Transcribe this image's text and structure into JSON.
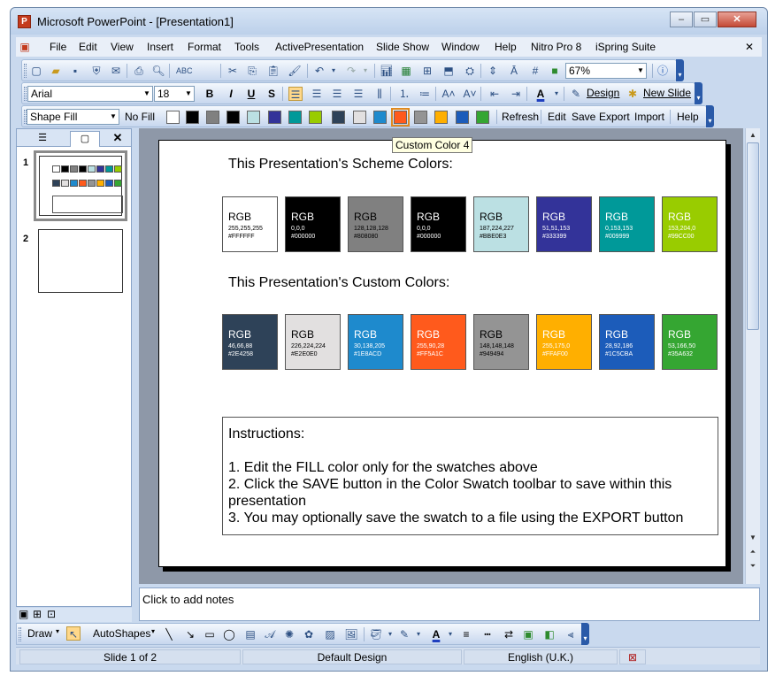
{
  "window": {
    "title": "Microsoft PowerPoint - [Presentation1]"
  },
  "menu": [
    "File",
    "Edit",
    "View",
    "Insert",
    "Format",
    "Tools",
    "ActivePresentation",
    "Slide Show",
    "Window",
    "Help",
    "Nitro Pro 8",
    "iSpring Suite"
  ],
  "standard_toolbar": {
    "zoom": "67%"
  },
  "format_toolbar": {
    "font": "Arial",
    "size": "18",
    "design_label": "Design",
    "new_slide_label": "New Slide"
  },
  "swatch_toolbar": {
    "shape_fill": "Shape Fill",
    "no_fill": "No Fill",
    "colors": [
      "#FFFFFF",
      "#000000",
      "#808080",
      "#000000",
      "#BBE0E3",
      "#333399",
      "#009999",
      "#99CC00",
      "#2E4258",
      "#E2E0E0",
      "#1E8ACD",
      "#FF5A1C",
      "#949494",
      "#FFAF00",
      "#1C5CBA",
      "#35A632"
    ],
    "buttons": [
      "Refresh",
      "Edit",
      "Save",
      "Export",
      "Import",
      "Help"
    ],
    "tooltip": "Custom Color 4"
  },
  "slides_pane": {
    "slide_numbers": [
      "1",
      "2"
    ]
  },
  "slide": {
    "scheme_heading": "This Presentation's Scheme Colors:",
    "custom_heading": "This Presentation's Custom Colors:",
    "scheme_swatches": [
      {
        "label": "RGB",
        "rgb": "255,255,255",
        "hex": "#FFFFFF",
        "color": "#FFFFFF",
        "text": "#000000"
      },
      {
        "label": "RGB",
        "rgb": "0,0,0",
        "hex": "#000000",
        "color": "#000000",
        "text": "#FFFFFF"
      },
      {
        "label": "RGB",
        "rgb": "128,128,128",
        "hex": "#808080",
        "color": "#808080",
        "text": "#000000"
      },
      {
        "label": "RGB",
        "rgb": "0,0,0",
        "hex": "#000000",
        "color": "#000000",
        "text": "#FFFFFF"
      },
      {
        "label": "RGB",
        "rgb": "187,224,227",
        "hex": "#BBE0E3",
        "color": "#BBE0E3",
        "text": "#000000"
      },
      {
        "label": "RGB",
        "rgb": "51,51,153",
        "hex": "#333399",
        "color": "#333399",
        "text": "#FFFFFF"
      },
      {
        "label": "RGB",
        "rgb": "0,153,153",
        "hex": "#009999",
        "color": "#009999",
        "text": "#FFFFFF"
      },
      {
        "label": "RGB",
        "rgb": "153,204,0",
        "hex": "#99CC00",
        "color": "#99CC00",
        "text": "#FFFFFF"
      }
    ],
    "custom_swatches": [
      {
        "label": "RGB",
        "rgb": "46,66,88",
        "hex": "#2E4258",
        "color": "#2E4258",
        "text": "#FFFFFF"
      },
      {
        "label": "RGB",
        "rgb": "226,224,224",
        "hex": "#E2E0E0",
        "color": "#E2E0E0",
        "text": "#000000"
      },
      {
        "label": "RGB",
        "rgb": "30,138,205",
        "hex": "#1E8ACD",
        "color": "#1E8ACD",
        "text": "#FFFFFF"
      },
      {
        "label": "RGB",
        "rgb": "255,90,28",
        "hex": "#FF5A1C",
        "color": "#FF5A1C",
        "text": "#FFFFFF"
      },
      {
        "label": "RGB",
        "rgb": "148,148,148",
        "hex": "#949494",
        "color": "#949494",
        "text": "#000000"
      },
      {
        "label": "RGB",
        "rgb": "255,175,0",
        "hex": "#FFAF00",
        "color": "#FFAF00",
        "text": "#FFFFFF"
      },
      {
        "label": "RGB",
        "rgb": "28,92,186",
        "hex": "#1C5CBA",
        "color": "#1C5CBA",
        "text": "#FFFFFF"
      },
      {
        "label": "RGB",
        "rgb": "53,166,50",
        "hex": "#35A632",
        "color": "#35A632",
        "text": "#FFFFFF"
      }
    ],
    "instructions": {
      "title": "Instructions:",
      "lines": [
        "1. Edit the FILL color only for the swatches above",
        "2. Click the SAVE button in the Color Swatch toolbar to save within this presentation",
        "3. You may optionally save the swatch to a file using the EXPORT button"
      ]
    }
  },
  "notes": {
    "placeholder": "Click to add notes"
  },
  "draw_toolbar": {
    "draw": "Draw",
    "autoshapes": "AutoShapes"
  },
  "status": {
    "slide": "Slide 1 of 2",
    "design": "Default Design",
    "language": "English (U.K.)"
  }
}
